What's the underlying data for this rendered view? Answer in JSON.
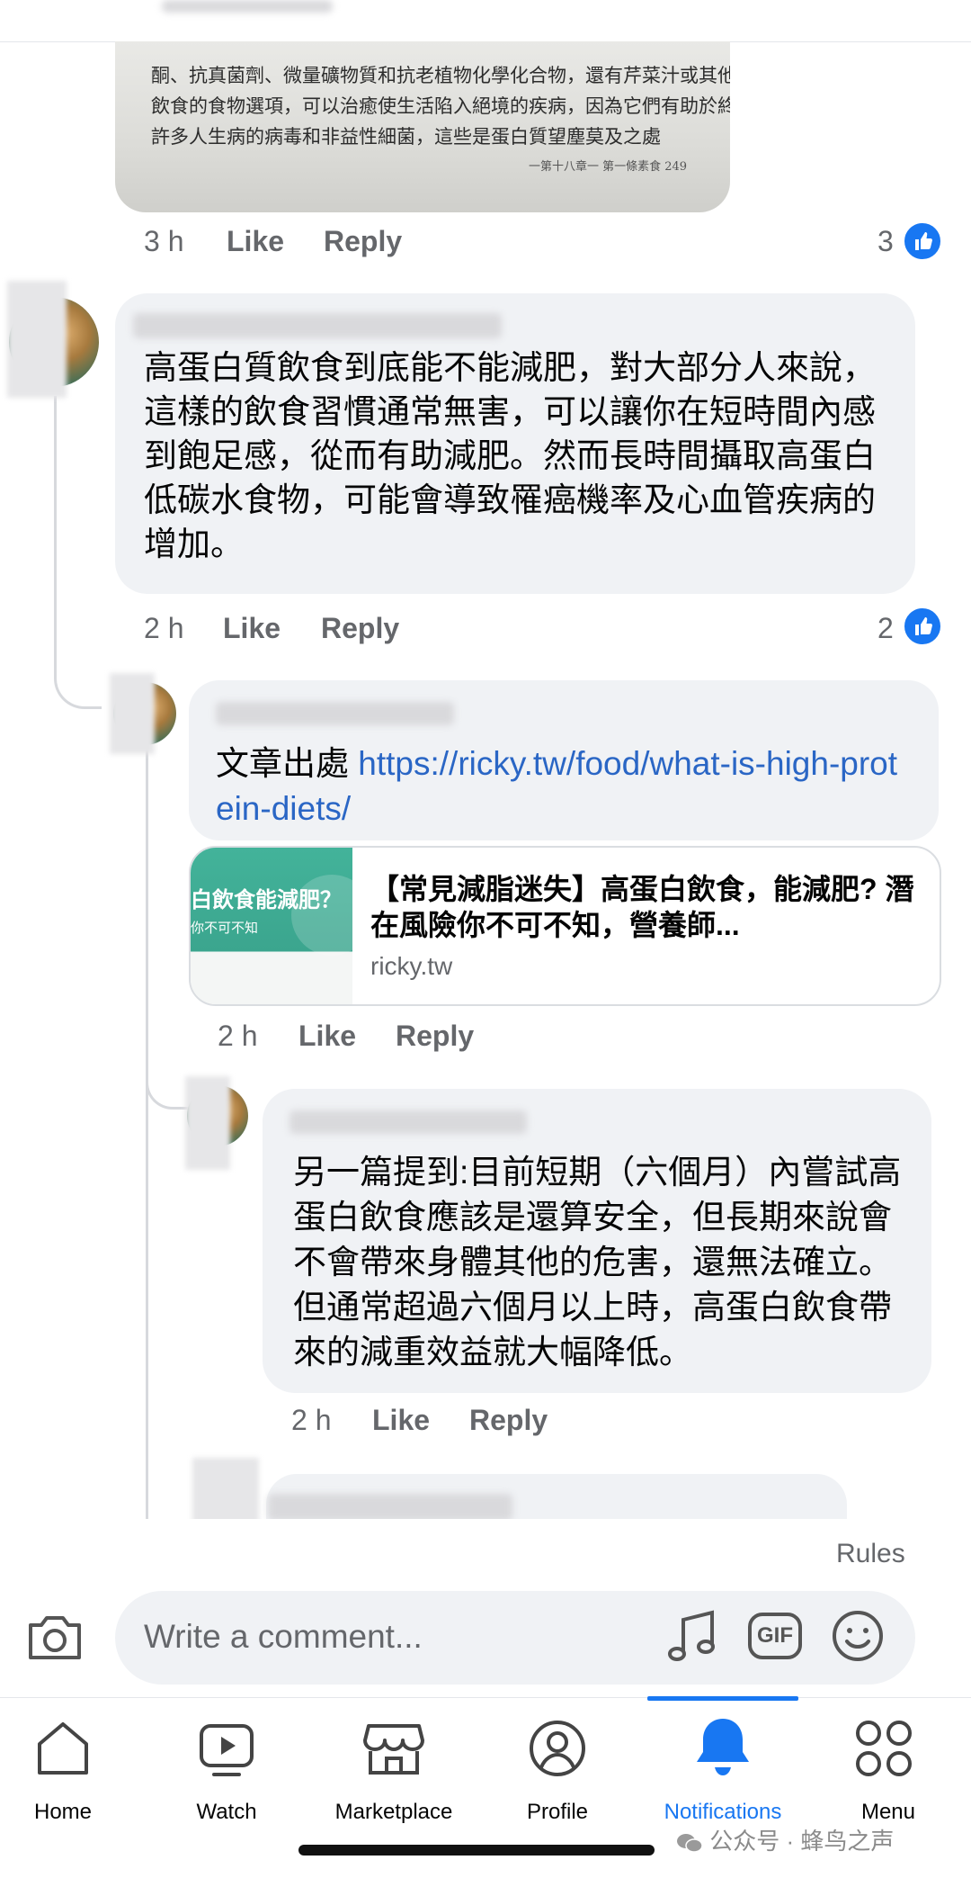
{
  "top_comment": {
    "image_lines": [
      "酮、抗真菌劑、微量礦物質和抗老植物化學化合物，還有芹菜汁或其他單一",
      "飲食的食物選項，可以治癒使生活陷入絕境的疾病，因為它們有助於終止導致",
      "許多人生病的病毒和非益性細菌，這些是蛋白質望塵莫及之處",
      "一第十八章一 第一條素食 249"
    ],
    "time": "3 h",
    "like": "Like",
    "reply": "Reply",
    "reactions": "3"
  },
  "comment1": {
    "text": "高蛋白質飲食到底能不能減肥，對大部分人來說，這樣的飲食習慣通常無害，可以讓你在短時間內感到飽足感，從而有助減肥。然而長時間攝取高蛋白低碳水食物，可能會導致罹癌機率及心血管疾病的增加。",
    "time": "2 h",
    "like": "Like",
    "reply": "Reply",
    "reactions": "2"
  },
  "reply1": {
    "prefix": "文章出處 ",
    "url": "https://ricky.tw/food/what-is-high-protein-diets/",
    "preview": {
      "thumb_title": "白飲食能減肥？",
      "thumb_sub": "你不可不知",
      "title": "【常見減脂迷失】高蛋白飲食，能減肥? 潛在風險你不可不知，營養師...",
      "domain": "ricky.tw"
    },
    "time": "2 h",
    "like": "Like",
    "reply": "Reply"
  },
  "reply2": {
    "text": "另一篇提到:目前短期（六個月）內嘗試高蛋白飲食應該是還算安全，但長期來說會不會帶來身體其他的危害，還無法確立。但通常超過六個月以上時，高蛋白飲食帶來的減重效益就大幅降低。",
    "time": "2 h",
    "like": "Like",
    "reply": "Reply"
  },
  "composer": {
    "rules": "Rules",
    "placeholder": "Write a comment...",
    "icons": [
      "camera-icon",
      "music-note-icon",
      "gif-icon",
      "smiley-icon"
    ]
  },
  "nav": {
    "items": [
      {
        "label": "Home",
        "icon": "home-icon"
      },
      {
        "label": "Watch",
        "icon": "watch-icon"
      },
      {
        "label": "Marketplace",
        "icon": "marketplace-icon"
      },
      {
        "label": "Profile",
        "icon": "profile-icon"
      },
      {
        "label": "Notifications",
        "icon": "bell-icon"
      },
      {
        "label": "Menu",
        "icon": "menu-grid-icon"
      }
    ],
    "active": "Notifications"
  },
  "watermark": "公众号 · 蜂鸟之声",
  "colors": {
    "accent": "#1877f2",
    "link": "#2a66c5",
    "bubble": "#f0f2f5",
    "meta": "#65676b",
    "preview_thumb": "#3fae94"
  }
}
